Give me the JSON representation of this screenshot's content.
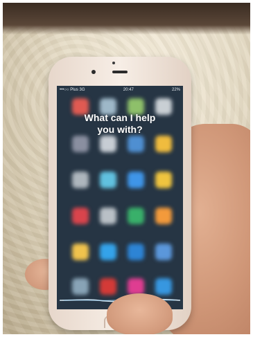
{
  "status_bar": {
    "carrier": "•••○○ Plus 3G",
    "time": "20:47",
    "battery": "22%"
  },
  "siri": {
    "prompt_line1": "What can I help",
    "prompt_line2": "you with?"
  },
  "colors": {
    "screen_background": "#263544",
    "siri_wave": "#dff3ff",
    "phone_body": "#f2e7df"
  },
  "icons": [
    "blurred-app-icon",
    "siri-waveform-icon",
    "home-button-icon"
  ]
}
